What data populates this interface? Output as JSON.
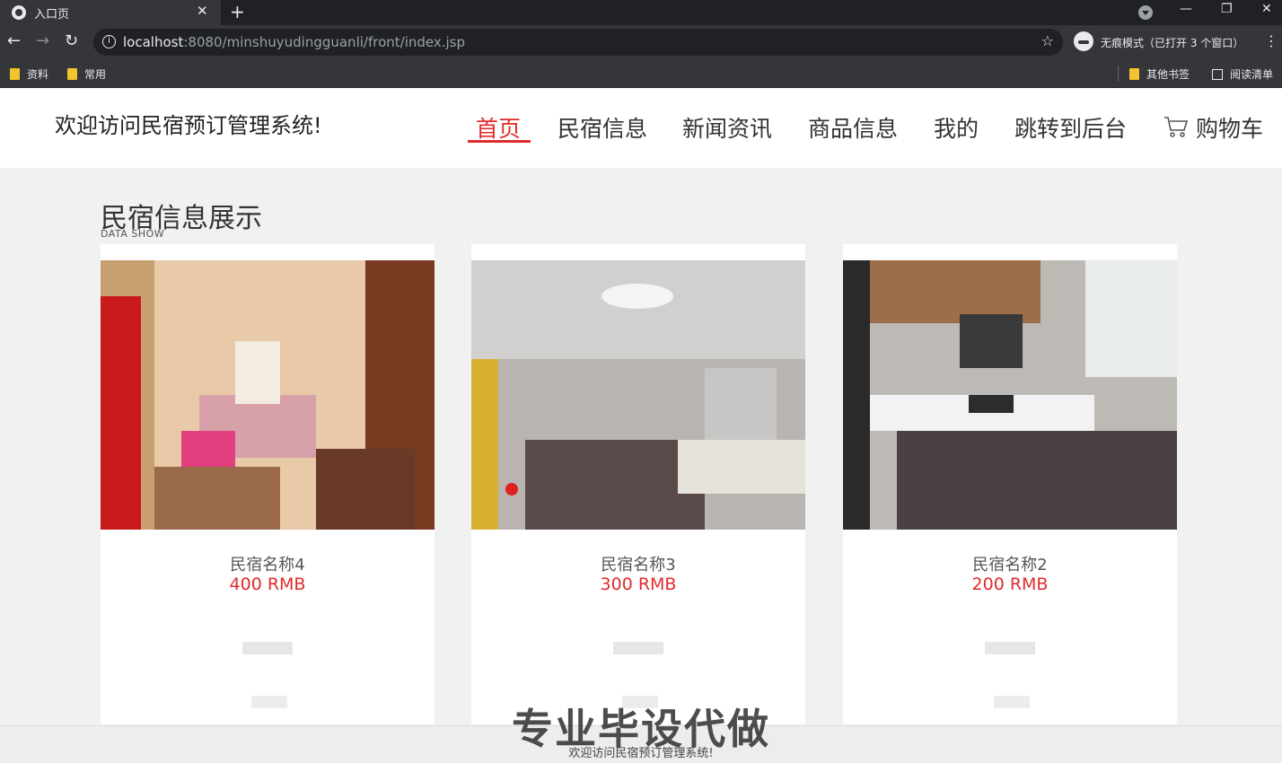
{
  "browser": {
    "tab_title": "入口页",
    "tab_close": "✕",
    "new_tab": "+",
    "url_host": "localhost",
    "url_rest": ":8080/minshuyudingguanli/front/index.jsp",
    "incognito_label": "无痕模式（已打开 3 个窗口）",
    "bookmarks": [
      "资料",
      "常用"
    ],
    "other_bookmarks": "其他书签",
    "reading_list": "阅读清单"
  },
  "header": {
    "welcome": "欢迎访问民宿预订管理系统!",
    "nav": [
      "首页",
      "民宿信息",
      "新闻资讯",
      "商品信息",
      "我的",
      "跳转到后台"
    ],
    "cart": "购物车"
  },
  "section": {
    "title": "民宿信息展示",
    "subtitle": "DATA SHOW"
  },
  "cards": [
    {
      "name": "民宿名称4",
      "price": "400 RMB"
    },
    {
      "name": "民宿名称3",
      "price": "300 RMB"
    },
    {
      "name": "民宿名称2",
      "price": "200 RMB"
    }
  ],
  "footer": {
    "text": "欢迎访问民宿预订管理系统!",
    "watermark": "专业毕设代做"
  },
  "colors": {
    "accent": "#e02b2b",
    "chrome_dark": "#202124",
    "chrome": "#35363a"
  }
}
